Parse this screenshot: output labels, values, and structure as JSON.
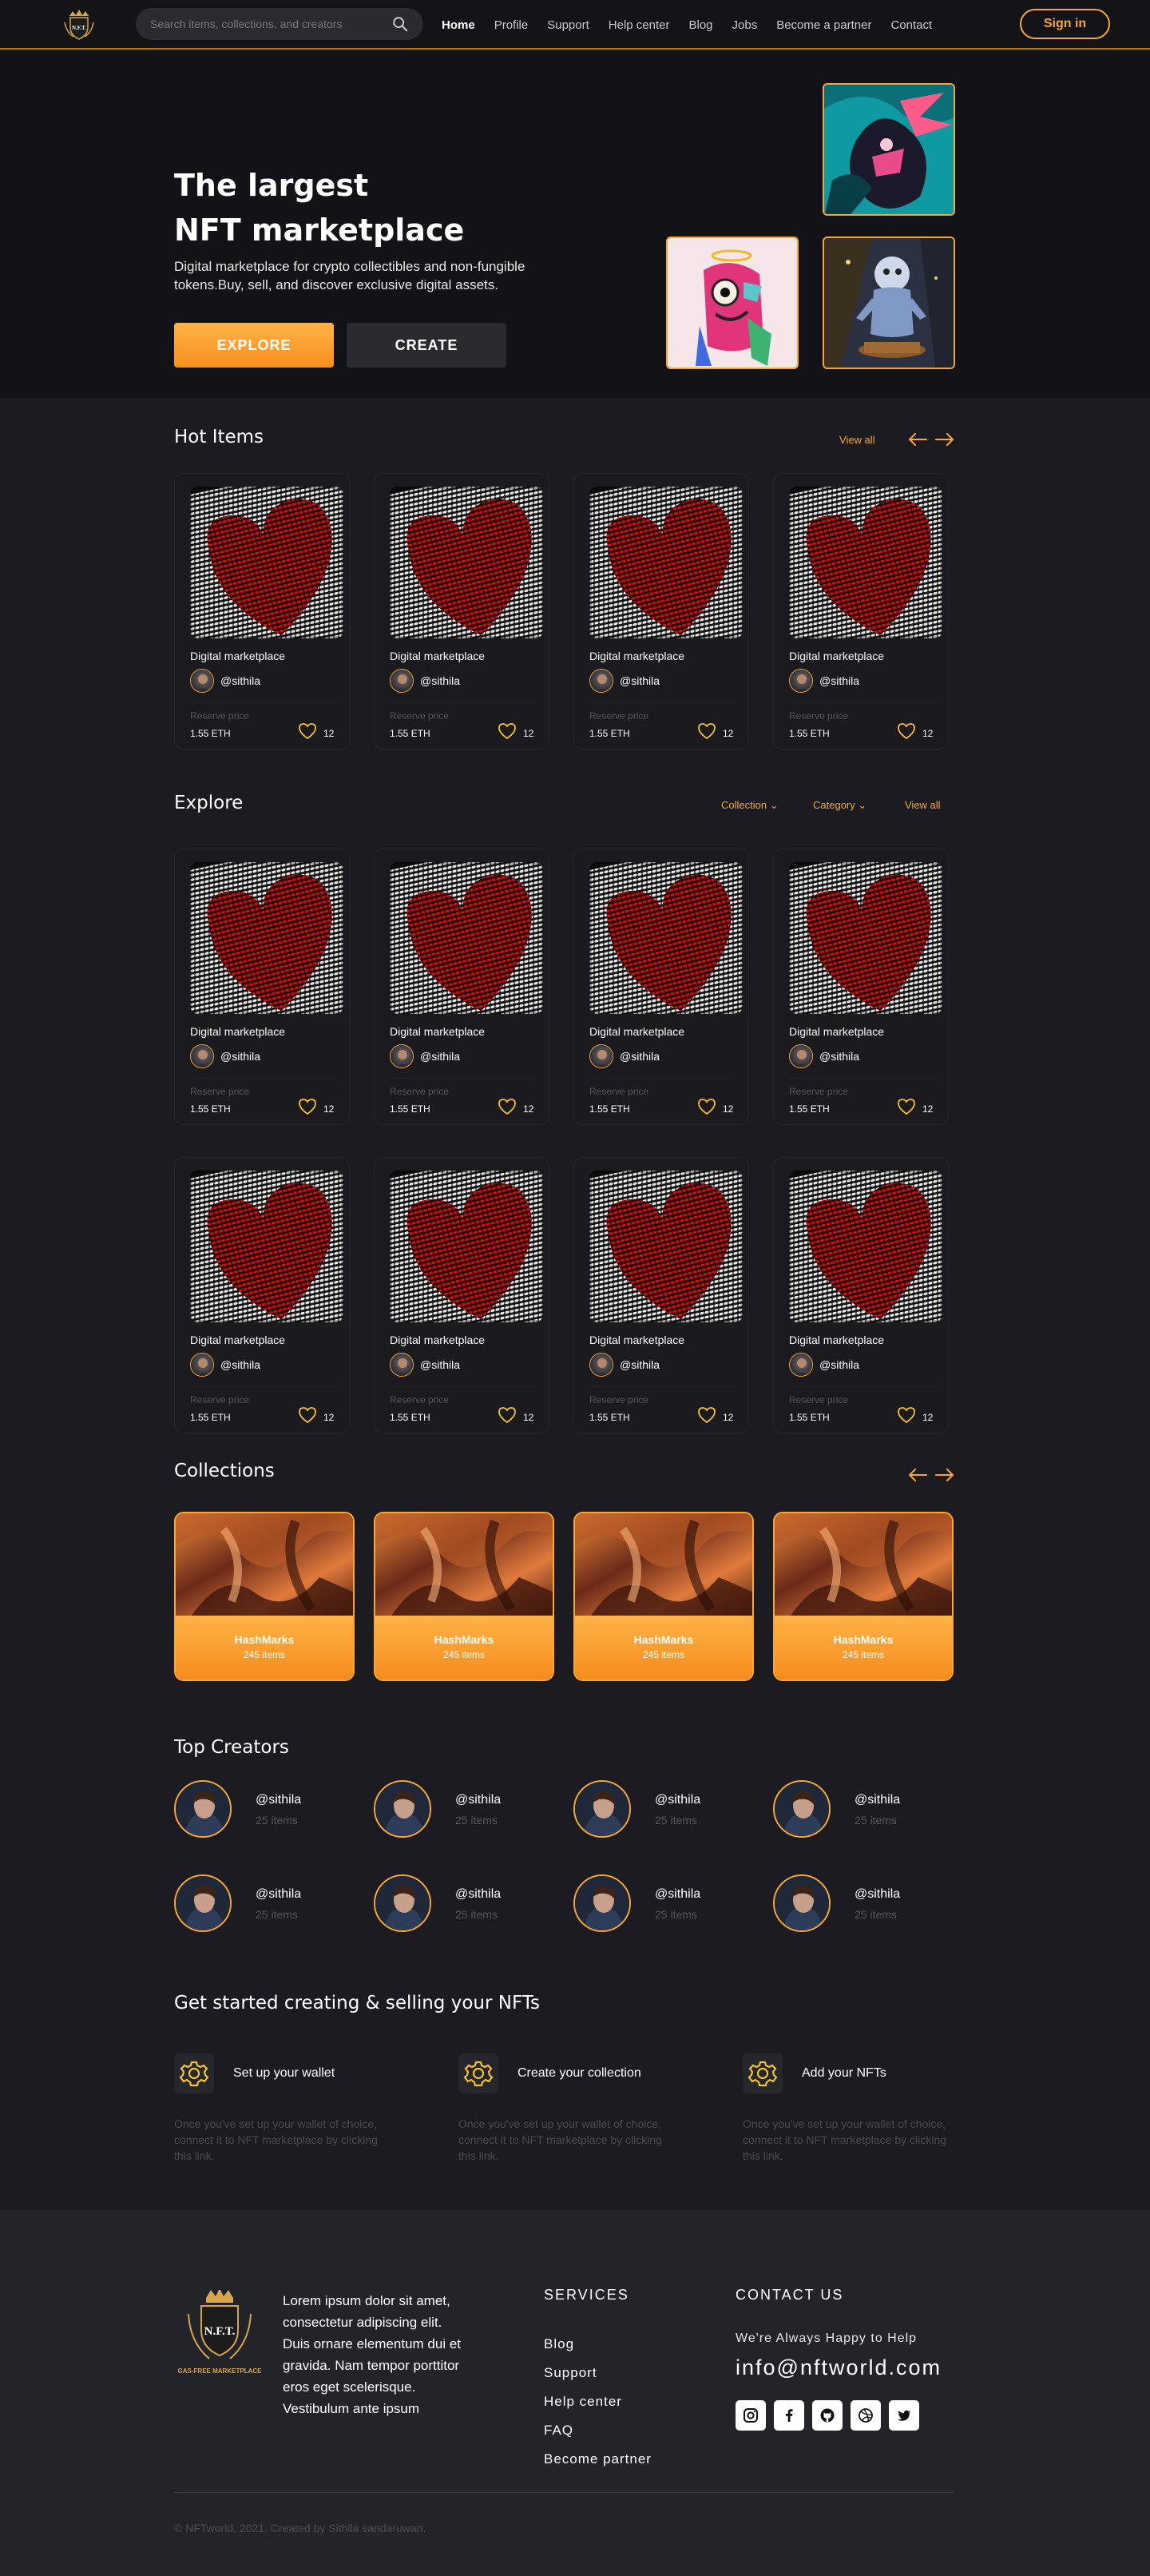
{
  "header": {
    "search_placeholder": "Search items, collections, and creators",
    "nav": [
      "Home",
      "Profile",
      "Support",
      "Help center",
      "Blog",
      "Jobs",
      "Become a partner",
      "Contact"
    ],
    "signin": "Sign in"
  },
  "hero": {
    "title_line1": "The largest",
    "title_line2": "NFT marketplace",
    "subtitle": "Digital marketplace for crypto collectibles and non-fungible tokens.Buy, sell, and discover exclusive digital assets.",
    "explore": "EXPLORE",
    "create": "CREATE"
  },
  "hot": {
    "title": "Hot Items",
    "view_all": "View all",
    "items": [
      {
        "title": "Digital marketplace",
        "user": "@sithila",
        "reserve_label": "Reserve price",
        "price": "1.55 ETH",
        "likes": "12"
      },
      {
        "title": "Digital marketplace",
        "user": "@sithila",
        "reserve_label": "Reserve price",
        "price": "1.55 ETH",
        "likes": "12"
      },
      {
        "title": "Digital marketplace",
        "user": "@sithila",
        "reserve_label": "Reserve price",
        "price": "1.55 ETH",
        "likes": "12"
      },
      {
        "title": "Digital marketplace",
        "user": "@sithila",
        "reserve_label": "Reserve price",
        "price": "1.55 ETH",
        "likes": "12"
      }
    ]
  },
  "explore": {
    "title": "Explore",
    "collection_filter": "Collection",
    "category_filter": "Category",
    "view_all": "View all",
    "items": [
      {
        "title": "Digital marketplace",
        "user": "@sithila",
        "reserve_label": "Reserve price",
        "price": "1.55 ETH",
        "likes": "12"
      },
      {
        "title": "Digital marketplace",
        "user": "@sithila",
        "reserve_label": "Reserve price",
        "price": "1.55 ETH",
        "likes": "12"
      },
      {
        "title": "Digital marketplace",
        "user": "@sithila",
        "reserve_label": "Reserve price",
        "price": "1.55 ETH",
        "likes": "12"
      },
      {
        "title": "Digital marketplace",
        "user": "@sithila",
        "reserve_label": "Reserve price",
        "price": "1.55 ETH",
        "likes": "12"
      },
      {
        "title": "Digital marketplace",
        "user": "@sithila",
        "reserve_label": "Reserve price",
        "price": "1.55 ETH",
        "likes": "12"
      },
      {
        "title": "Digital marketplace",
        "user": "@sithila",
        "reserve_label": "Reserve price",
        "price": "1.55 ETH",
        "likes": "12"
      },
      {
        "title": "Digital marketplace",
        "user": "@sithila",
        "reserve_label": "Reserve price",
        "price": "1.55 ETH",
        "likes": "12"
      },
      {
        "title": "Digital marketplace",
        "user": "@sithila",
        "reserve_label": "Reserve price",
        "price": "1.55 ETH",
        "likes": "12"
      }
    ]
  },
  "collections": {
    "title": "Collections",
    "items": [
      {
        "name": "HashMarks",
        "count": "245 items"
      },
      {
        "name": "HashMarks",
        "count": "245 items"
      },
      {
        "name": "HashMarks",
        "count": "245 items"
      },
      {
        "name": "HashMarks",
        "count": "245 items"
      }
    ]
  },
  "creators": {
    "title": "Top Creators",
    "items": [
      {
        "name": "@sithila",
        "count": "25 items"
      },
      {
        "name": "@sithila",
        "count": "25 items"
      },
      {
        "name": "@sithila",
        "count": "25 items"
      },
      {
        "name": "@sithila",
        "count": "25 items"
      },
      {
        "name": "@sithila",
        "count": "25 items"
      },
      {
        "name": "@sithila",
        "count": "25 items"
      },
      {
        "name": "@sithila",
        "count": "25 items"
      },
      {
        "name": "@sithila",
        "count": "25 items"
      }
    ]
  },
  "steps": {
    "title": "Get started creating & selling your NFTs",
    "items": [
      {
        "title": "Set up your wallet",
        "desc": "Once you've set up your wallet of choice, connect it to NFT marketplace by clicking this link."
      },
      {
        "title": "Create your collection",
        "desc": "Once you've set up your wallet of choice, connect it to NFT marketplace by clicking this link."
      },
      {
        "title": "Add your NFTs",
        "desc": "Once you've set up your wallet of choice, connect it to NFT marketplace by clicking this link."
      }
    ]
  },
  "footer": {
    "logo_text": "N.F.T.",
    "logo_sub": "GAS-FREE MARKETPLACE",
    "about": "Lorem ipsum dolor sit amet, consectetur adipiscing elit. Duis ornare elementum dui et gravida. Nam tempor porttitor eros eget scelerisque. Vestibulum ante ipsum",
    "services_title": "SERVICES",
    "services": [
      "Blog",
      "Support",
      "Help center",
      "FAQ",
      "Become partner"
    ],
    "contact_title": "CONTACT US",
    "happy": "We're Always Happy to Help",
    "email": "info@nftworld.com",
    "socials": [
      "instagram-icon",
      "facebook-icon",
      "github-icon",
      "dribbble-icon",
      "twitter-icon"
    ],
    "copyright": "© NFTworld, 2021. Created by Sithila sandaruwan."
  },
  "colors": {
    "accent": "#f7a733",
    "bg": "#1b1b21",
    "hero_bg": "#131317"
  }
}
